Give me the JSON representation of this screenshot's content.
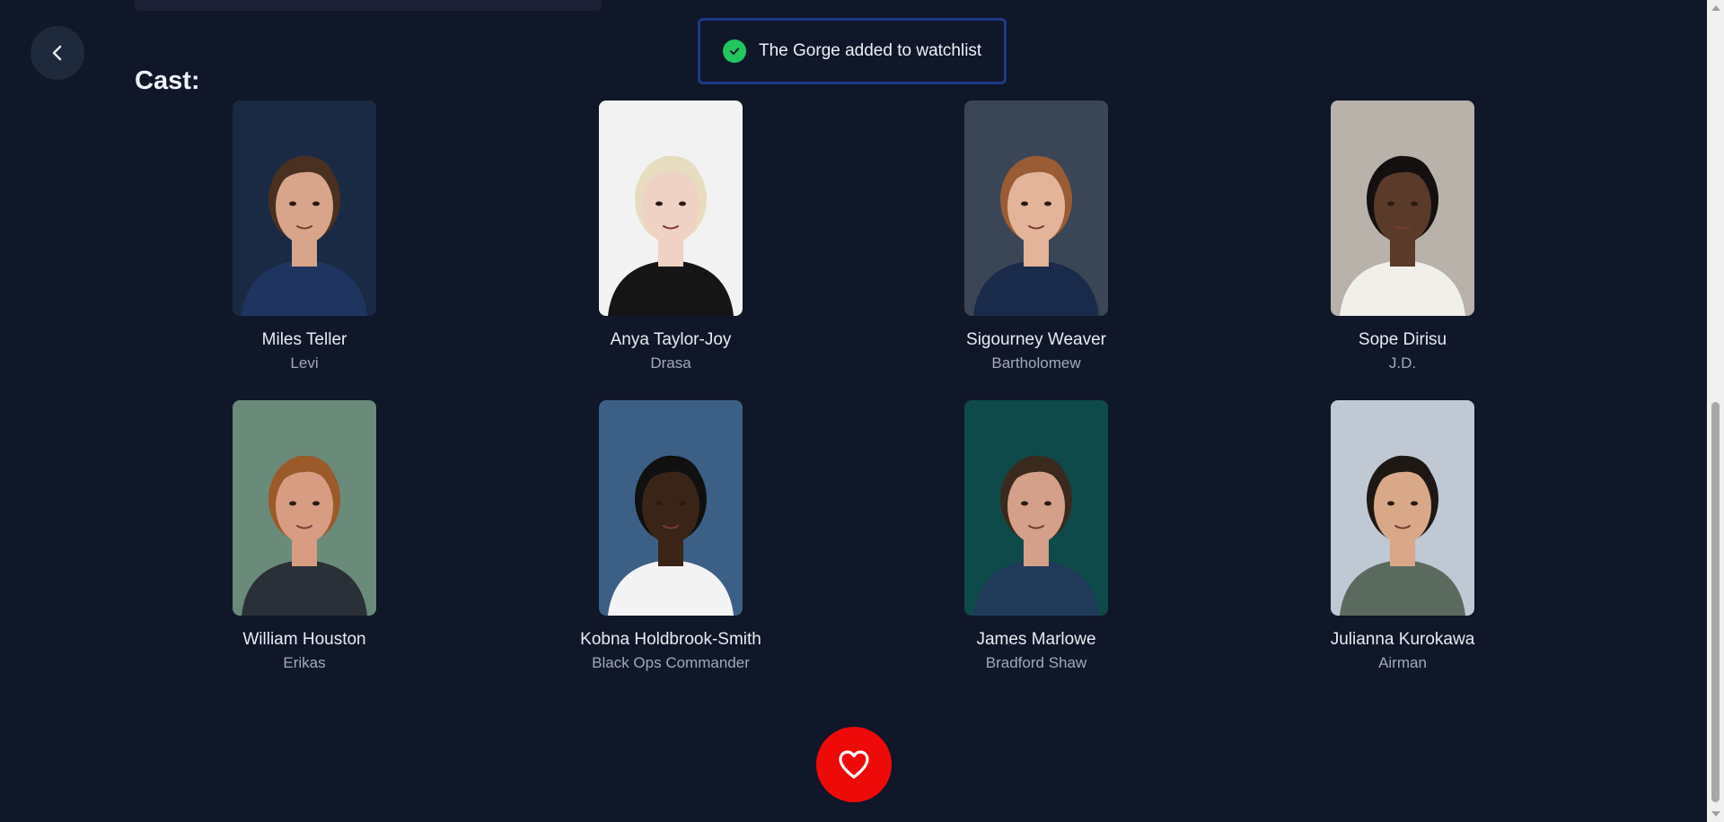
{
  "toast": {
    "message": "The Gorge added to watchlist",
    "status_color": "#22c55e"
  },
  "section": {
    "title": "Cast:"
  },
  "cast": [
    {
      "name": "Miles Teller",
      "role": "Levi",
      "photo_bg": "#1a2a45",
      "skin": "#d8a58a",
      "hair": "#4a3020",
      "shirt": "#1f3560"
    },
    {
      "name": "Anya Taylor-Joy",
      "role": "Drasa",
      "photo_bg": "#f2f2f2",
      "skin": "#f0d2c4",
      "hair": "#e8dcc0",
      "shirt": "#151515"
    },
    {
      "name": "Sigourney Weaver",
      "role": "Bartholomew",
      "photo_bg": "#3a4555",
      "skin": "#e3b49a",
      "hair": "#9a5c35",
      "shirt": "#1a2a4a"
    },
    {
      "name": "Sope Dirisu",
      "role": "J.D.",
      "photo_bg": "#b8b2aa",
      "skin": "#5a3a28",
      "hair": "#151010",
      "shirt": "#f1efea"
    },
    {
      "name": "William Houston",
      "role": "Erikas",
      "photo_bg": "#6a8a7a",
      "skin": "#d79c82",
      "hair": "#9a5a2a",
      "shirt": "#2a3038"
    },
    {
      "name": "Kobna Holdbrook-Smith",
      "role": "Black Ops Commander",
      "photo_bg": "#3c5f85",
      "skin": "#3a2418",
      "hair": "#101010",
      "shirt": "#f3f3f3"
    },
    {
      "name": "James Marlowe",
      "role": "Bradford Shaw",
      "photo_bg": "#0f4a4a",
      "skin": "#d4a08a",
      "hair": "#3a2a1e",
      "shirt": "#203a5a"
    },
    {
      "name": "Julianna Kurokawa",
      "role": "Airman",
      "photo_bg": "#c0c8d4",
      "skin": "#d8a888",
      "hair": "#1e1814",
      "shirt": "#5a6a5e"
    }
  ],
  "theme": {
    "background": "#0f1729",
    "favorite_color": "#ef0a0a",
    "toast_border": "#1e3a8a"
  }
}
